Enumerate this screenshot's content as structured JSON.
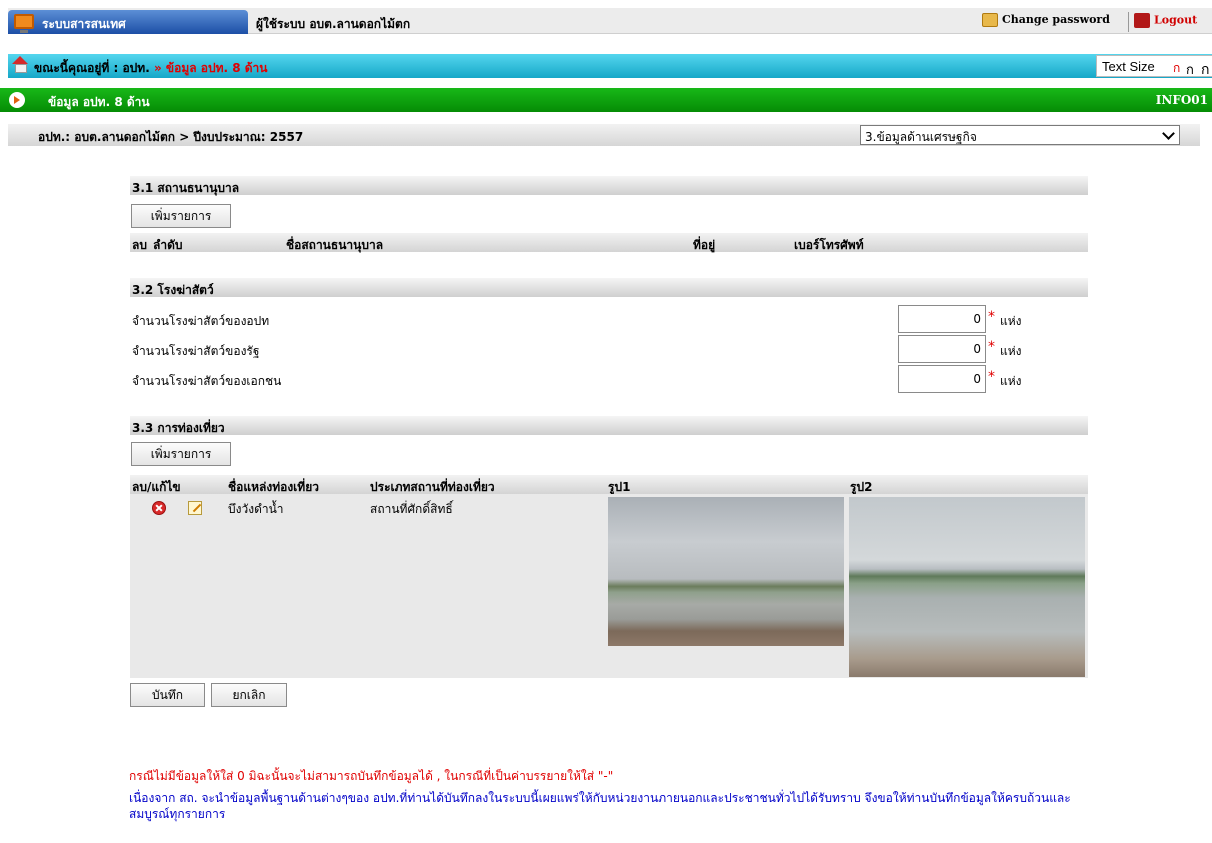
{
  "topbar": {
    "system_tab": "ระบบสารสนเทศ",
    "user": "ผู้ใช้ระบบ อบต.ลานดอกไม้ตก",
    "change_password": "Change password",
    "logout": "Logout"
  },
  "breadcrumb": {
    "prefix": "ขณะนี้คุณอยู่ที่ :",
    "level1": "อปท.",
    "separator": "»",
    "current": "ข้อมูล อปท. 8 ด้าน",
    "text_size_label": "Text Size",
    "text_size_options": [
      "ก",
      "ก",
      "ก"
    ]
  },
  "section": {
    "title": "ข้อมูล อปท. 8 ด้าน",
    "code": "INFO01"
  },
  "header": {
    "info": "อปท.: อบต.ลานดอกไม้ตก  > ปีงบประมาณ: 2557",
    "category_selected": "3.ข้อมูลด้านเศรษฐกิจ"
  },
  "nursery": {
    "title": "3.1 สถานธนานุบาล",
    "add_button": "เพิ่มรายการ",
    "columns": [
      "ลบ",
      "ลำดับ",
      "ชื่อสถานธนานุบาล",
      "ที่อยู่",
      "เบอร์โทรศัพท์"
    ]
  },
  "slaughter": {
    "title": "3.2 โรงฆ่าสัตว์",
    "rows": [
      {
        "label": "จำนวนโรงฆ่าสัตว์ของอปท",
        "value": "0",
        "unit": "แห่ง"
      },
      {
        "label": "จำนวนโรงฆ่าสัตว์ของรัฐ",
        "value": "0",
        "unit": "แห่ง"
      },
      {
        "label": "จำนวนโรงฆ่าสัตว์ของเอกชน",
        "value": "0",
        "unit": "แห่ง"
      }
    ],
    "required_mark": "*"
  },
  "tourism": {
    "title": "3.3 การท่องเที่ยว",
    "add_button": "เพิ่มรายการ",
    "columns": [
      "ลบ/แก้ไข",
      "ชื่อแหล่งท่องเที่ยว",
      "ประเภทสถานที่ท่องเที่ยว",
      "รูป1",
      "รูป2"
    ],
    "rows": [
      {
        "name": "บึงวังดำน้ำ",
        "type": "สถานที่ศักดิ์สิทธิ์"
      }
    ]
  },
  "actions": {
    "save": "บันทึก",
    "cancel": "ยกเลิก"
  },
  "notes": {
    "red": "กรณีไม่มีข้อมูลให้ใส่ 0 มิฉะนั้นจะไม่สามารถบันทึกข้อมูลได้ , ในกรณีที่เป็นค่าบรรยายให้ใส่ \"-\"",
    "blue": "เนื่องจาก สถ. จะนำข้อมูลพื้นฐานด้านต่างๆของ อปท.ที่ท่านได้บันทึกลงในระบบนี้เผยแพร่ให้กับหน่วยงานภายนอกและประชาชนทั่วไปได้รับทราบ จึงขอให้ท่านบันทึกข้อมูลให้ครบถ้วนและสมบูรณ์ทุกรายการ"
  }
}
